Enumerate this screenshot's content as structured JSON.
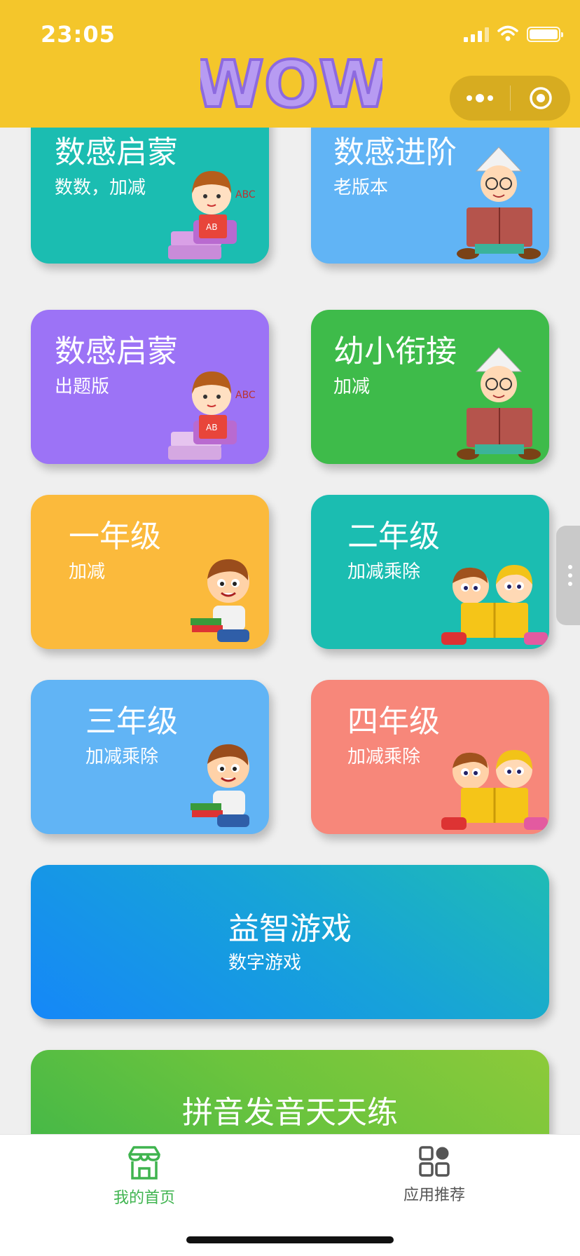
{
  "status_bar": {
    "time": "23:05"
  },
  "header": {
    "logo_text": "WOW"
  },
  "cards": [
    {
      "title": "数感启蒙",
      "subtitle": "数数，加减",
      "color": "#1bbdb1"
    },
    {
      "title": "数感进阶",
      "subtitle": "老版本",
      "color": "#61b4f5"
    },
    {
      "title": "数感启蒙",
      "subtitle": "出题版",
      "color": "#9c73f6"
    },
    {
      "title": "幼小衔接",
      "subtitle": "加减",
      "color": "#3ebb4a"
    },
    {
      "title": "一年级",
      "subtitle": "加减",
      "color": "#fbba3c"
    },
    {
      "title": "二年级",
      "subtitle": "加减乘除",
      "color": "#1bbdb1"
    },
    {
      "title": "三年级",
      "subtitle": "加减乘除",
      "color": "#61b4f5"
    },
    {
      "title": "四年级",
      "subtitle": "加减乘除",
      "color": "#f7877a"
    },
    {
      "title": "益智游戏",
      "subtitle": "数字游戏",
      "color": "#1587f8"
    },
    {
      "title": "拼音发音天天练",
      "subtitle": "",
      "color": "#3bb54a"
    }
  ],
  "tabbar": {
    "home_label": "我的首页",
    "apps_label": "应用推荐",
    "active_color": "#3fb44f"
  }
}
